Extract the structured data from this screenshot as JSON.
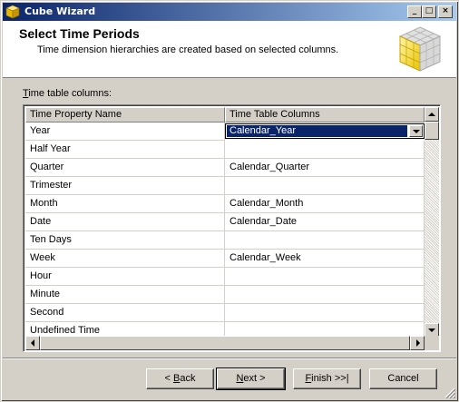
{
  "window": {
    "title": "Cube Wizard",
    "controls": {
      "minimize": "_",
      "maximize": "□",
      "close": "×"
    }
  },
  "header": {
    "title": "Select Time Periods",
    "description": "Time dimension hierarchies are created based on selected columns."
  },
  "grid": {
    "label_mnemonic": "T",
    "label_rest": "ime table columns:",
    "columns": [
      "Time Property Name",
      "Time Table Columns"
    ],
    "rows": [
      {
        "property": "Year",
        "column": "Calendar_Year",
        "editing": true
      },
      {
        "property": "Half Year",
        "column": ""
      },
      {
        "property": "Quarter",
        "column": "Calendar_Quarter"
      },
      {
        "property": "Trimester",
        "column": ""
      },
      {
        "property": "Month",
        "column": "Calendar_Month"
      },
      {
        "property": "Date",
        "column": "Calendar_Date"
      },
      {
        "property": "Ten Days",
        "column": ""
      },
      {
        "property": "Week",
        "column": "Calendar_Week"
      },
      {
        "property": "Hour",
        "column": ""
      },
      {
        "property": "Minute",
        "column": ""
      },
      {
        "property": "Second",
        "column": ""
      },
      {
        "property": "Undefined Time",
        "column": ""
      }
    ]
  },
  "buttons": {
    "back": {
      "mnemonic": "B",
      "rest": "ack",
      "prefix": "< "
    },
    "next": {
      "mnemonic": "N",
      "rest": "ext >",
      "prefix": ""
    },
    "finish": {
      "mnemonic": "F",
      "rest": "inish >>|",
      "prefix": ""
    },
    "cancel": {
      "label": "Cancel"
    }
  },
  "colors": {
    "titlebar_start": "#0a246a",
    "titlebar_end": "#a6caf0",
    "selection": "#0a246a",
    "face": "#d4d0c8"
  },
  "icons": [
    "cube-wizard-icon",
    "cube-graphic",
    "dropdown-arrow-icon",
    "scroll-up-icon",
    "scroll-down-icon",
    "scroll-left-icon",
    "scroll-right-icon",
    "size-grip-icon"
  ]
}
